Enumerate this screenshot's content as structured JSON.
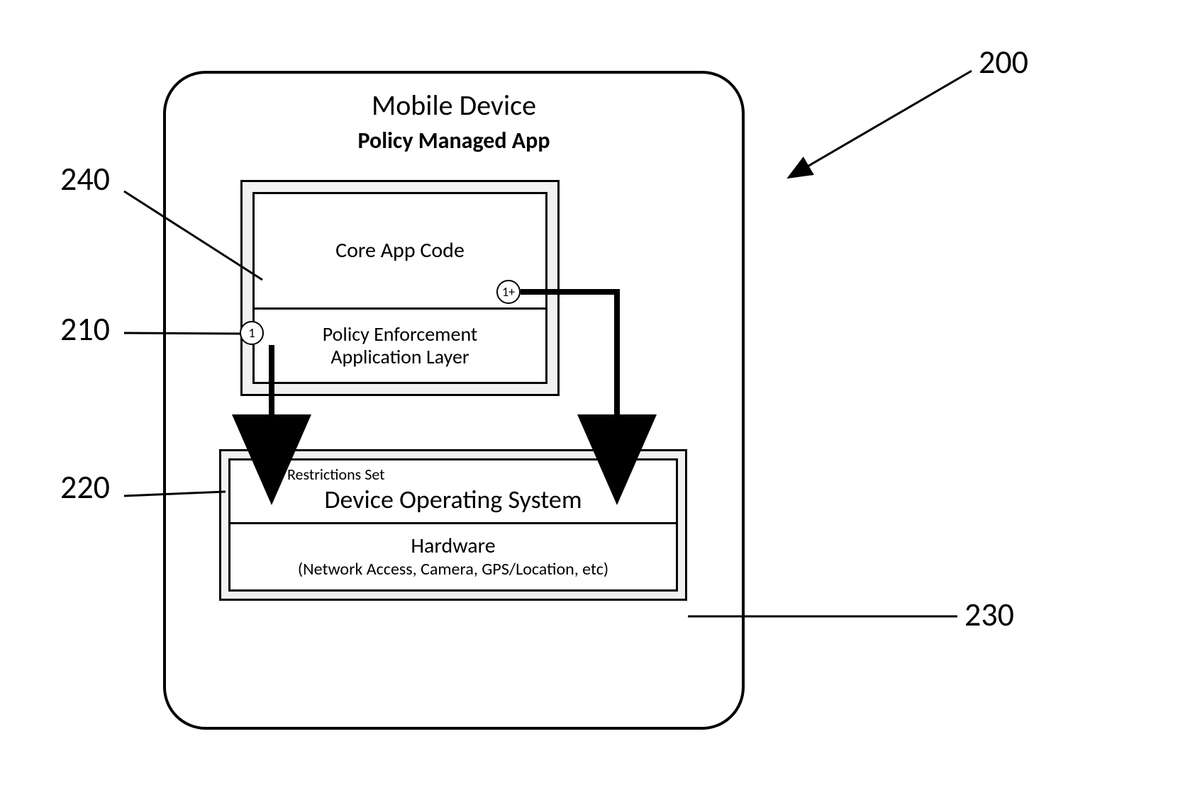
{
  "device": {
    "title": "Mobile Device",
    "app_section_title": "Policy Managed App",
    "core_app_code": "Core App Code",
    "policy_layer": "Policy Enforcement\nApplication Layer",
    "restrictions_set": "Restrictions Set",
    "os_title": "Device Operating System",
    "hardware_title": "Hardware",
    "hardware_sub": "(Network Access, Camera, GPS/Location, etc)"
  },
  "badges": {
    "one": "1",
    "one_plus": "1+"
  },
  "refs": {
    "r200": "200",
    "r240": "240",
    "r210": "210",
    "r220": "220",
    "r230": "230"
  }
}
